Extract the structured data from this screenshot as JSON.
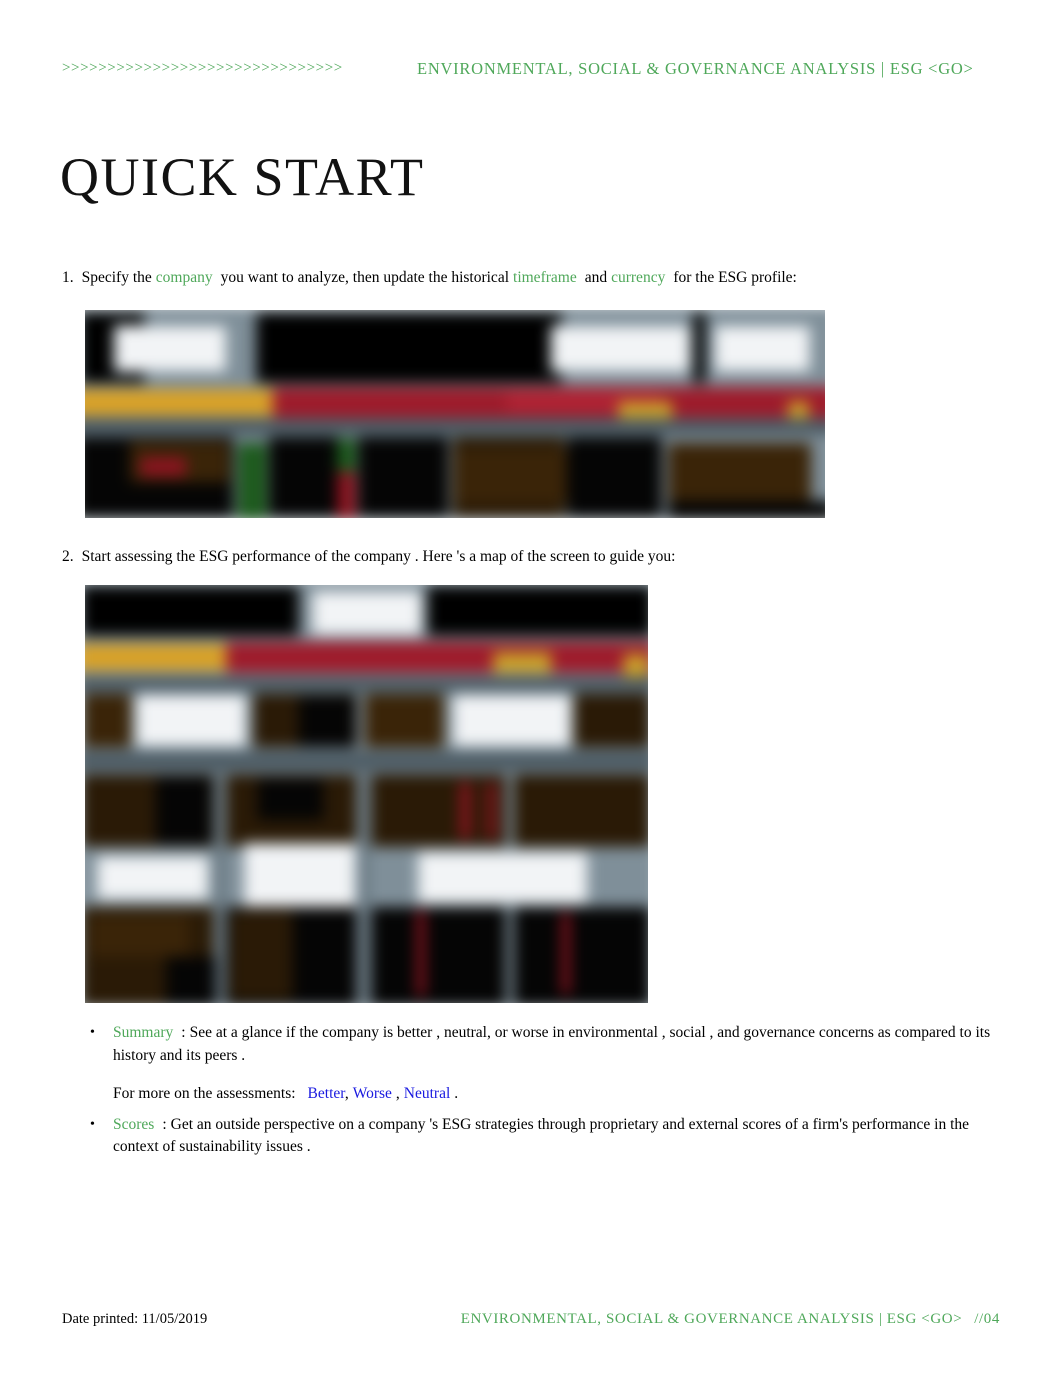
{
  "header": {
    "arrows": ">>>>>>>>>>>>>>>>>>>>>>>>>>>>>>>",
    "title": "ENVIRONMENTAL,  SOCIAL  & GOVERNANCE   ANALYSIS  | ESG  <GO>"
  },
  "page_title": "QUICK  START",
  "steps": [
    {
      "number": "1.",
      "part1": "Specify  the",
      "green1": "company",
      "part2": "you want to analyze, then update   the historical",
      "green2": "timeframe",
      "part3": "and",
      "green3": "currency",
      "part4": "for the  ESG  profile:"
    },
    {
      "number": "2.",
      "text": "Start  assessing   the  ESG   performance   of the  company . Here 's  a  map  of the  screen   to guide  you:"
    }
  ],
  "bullets": [
    {
      "label": "Summary",
      "separator": ":",
      "text": "See  at a  glance  if the  company  is better ,  neutral,  or worse  in environmental , social , and  governance  concerns   as  compared  to its history and  its peers ."
    },
    {
      "label": "Scores",
      "separator": ":",
      "text": "Get an  outside  perspective  on a  company 's ESG  strategies  through  proprietary and  external  scores  of a firm's  performance   in the context  of sustainability  issues ."
    }
  ],
  "sub_note": {
    "lead": "For more  on the  assessments:",
    "links": [
      "Better",
      "Worse",
      "Neutral"
    ],
    "link_sep": ",",
    "period": "."
  },
  "footer": {
    "date_label": "Date printed: 11/05/2019",
    "title": "ENVIRONMENTAL,  SOCIAL  & GOVERNANCE   ANALYSIS  | ESG  <GO>",
    "page_number": "//04"
  },
  "figures": {
    "figure1_caption": "blurred-terminal-screenshot-company-timeframe-currency",
    "figure2_caption": "blurred-terminal-screenshot-esg-screen-map"
  },
  "colors": {
    "accent_green": "#4fa85a",
    "link_blue": "#1a1ae0",
    "terminal_amber": "#d9a227",
    "terminal_red": "#9e1b2b"
  }
}
